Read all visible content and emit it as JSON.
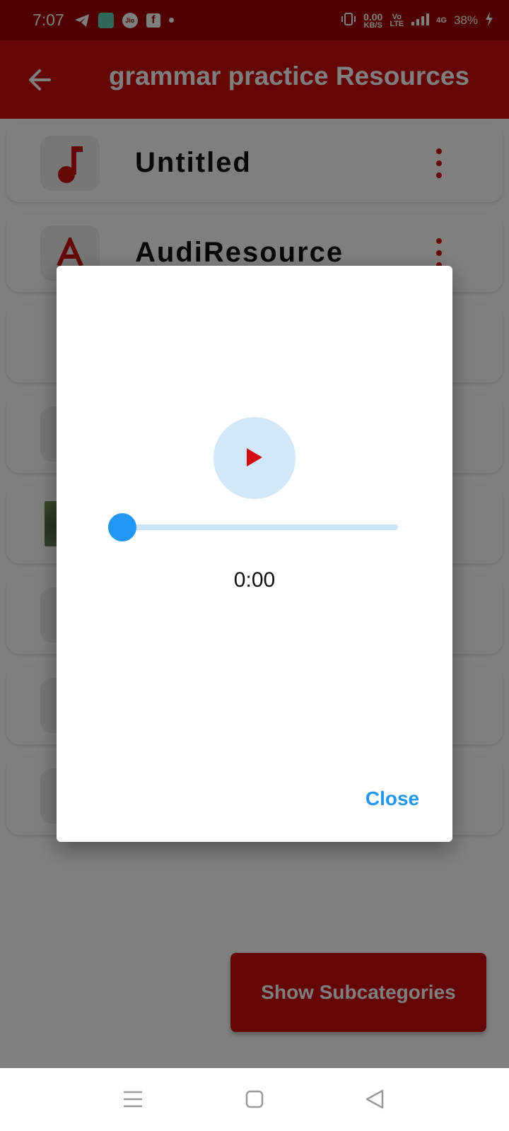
{
  "status_bar": {
    "time": "7:07",
    "net_speed": "0.00",
    "net_unit": "KB/S",
    "volte_top": "Vo",
    "volte_bottom": "LTE",
    "network": "4G",
    "battery": "38%"
  },
  "app_bar": {
    "title": "grammar practice Resources"
  },
  "resources": [
    {
      "label": "Untitled",
      "icon": "music-note-icon"
    },
    {
      "label": "AudiResource",
      "icon": "letter-a-icon"
    },
    {
      "label": "",
      "icon": "document-icon"
    },
    {
      "label": "",
      "icon": "music-note-icon"
    },
    {
      "label": "",
      "icon": "image-thumbnail"
    },
    {
      "label": "",
      "icon": "music-note-icon"
    },
    {
      "label": "",
      "icon": "music-note-icon"
    },
    {
      "label": "",
      "icon": "music-note-icon"
    }
  ],
  "fab": {
    "label": "Show Subcategories"
  },
  "dialog": {
    "position_text": "0:00",
    "progress": 0,
    "close_label": "Close"
  },
  "colors": {
    "primary": "#c80c0c",
    "status_bar": "#a00000",
    "accent_blue": "#2196f3",
    "play_circle": "#d3e7fa"
  }
}
